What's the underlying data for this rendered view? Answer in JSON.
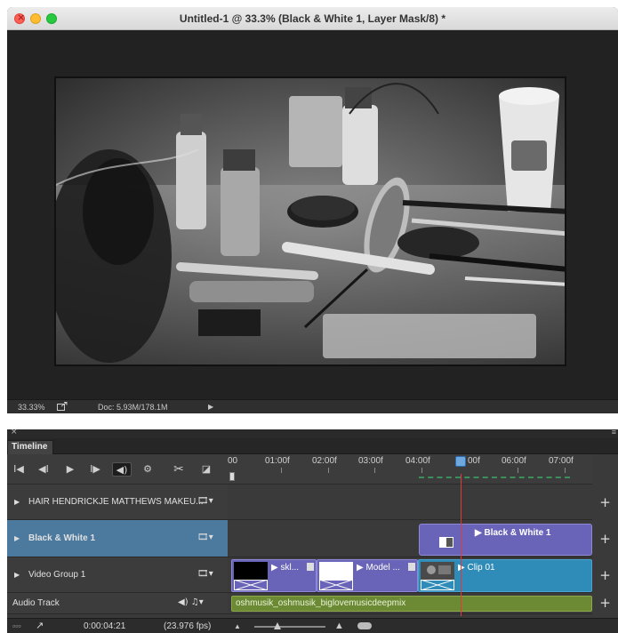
{
  "window": {
    "title": "Untitled-1 @ 33.3% (Black & White 1, Layer Mask/8) *"
  },
  "status": {
    "zoom": "33.33%",
    "doc_info": "Doc: 5.93M/178.1M",
    "menu_arrow": "▶"
  },
  "panel": {
    "close_glyph": "×",
    "menu_glyph": "≡"
  },
  "timeline": {
    "tab_label": "Timeline",
    "controls": {
      "go_first": "I◀",
      "step_back": "◀I",
      "play": "▶",
      "step_forward": "I▶",
      "audio": "◀)",
      "settings": "⚙",
      "split": "✂",
      "transition": "◪"
    },
    "ruler_ticks": [
      "00",
      "01:00f",
      "02:00f",
      "03:00f",
      "04:00f",
      "05:00f",
      "06:00f",
      "07:00f"
    ],
    "playhead_label": "00f",
    "tracks": [
      {
        "name": "HAIR  HENDRICKJE MATTHEWS  MAKEU...",
        "icon": "🎞▾"
      },
      {
        "name": "Black & White 1",
        "icon": "🎞▾"
      },
      {
        "name": "Video Group 1",
        "icon": "🎞▾"
      },
      {
        "name": "Audio Track",
        "icon": "◀)  ♫▾"
      }
    ],
    "clips": {
      "adjustment": "▶  Black & White 1",
      "video": [
        {
          "label": "▶ skl..."
        },
        {
          "label": "▶ Model ..."
        },
        {
          "label": "▶ Clip 01"
        }
      ],
      "audio": "oshmusik_oshmusik_biglovemusicdeepmix"
    },
    "add_glyph": "+",
    "bottom": {
      "frames_icon": "▫▫▫",
      "arrow": "↗",
      "current_time": "0:00:04:21",
      "fps": "(23.976 fps)",
      "zoom_out": "▲",
      "zoom_in": "▲"
    }
  }
}
